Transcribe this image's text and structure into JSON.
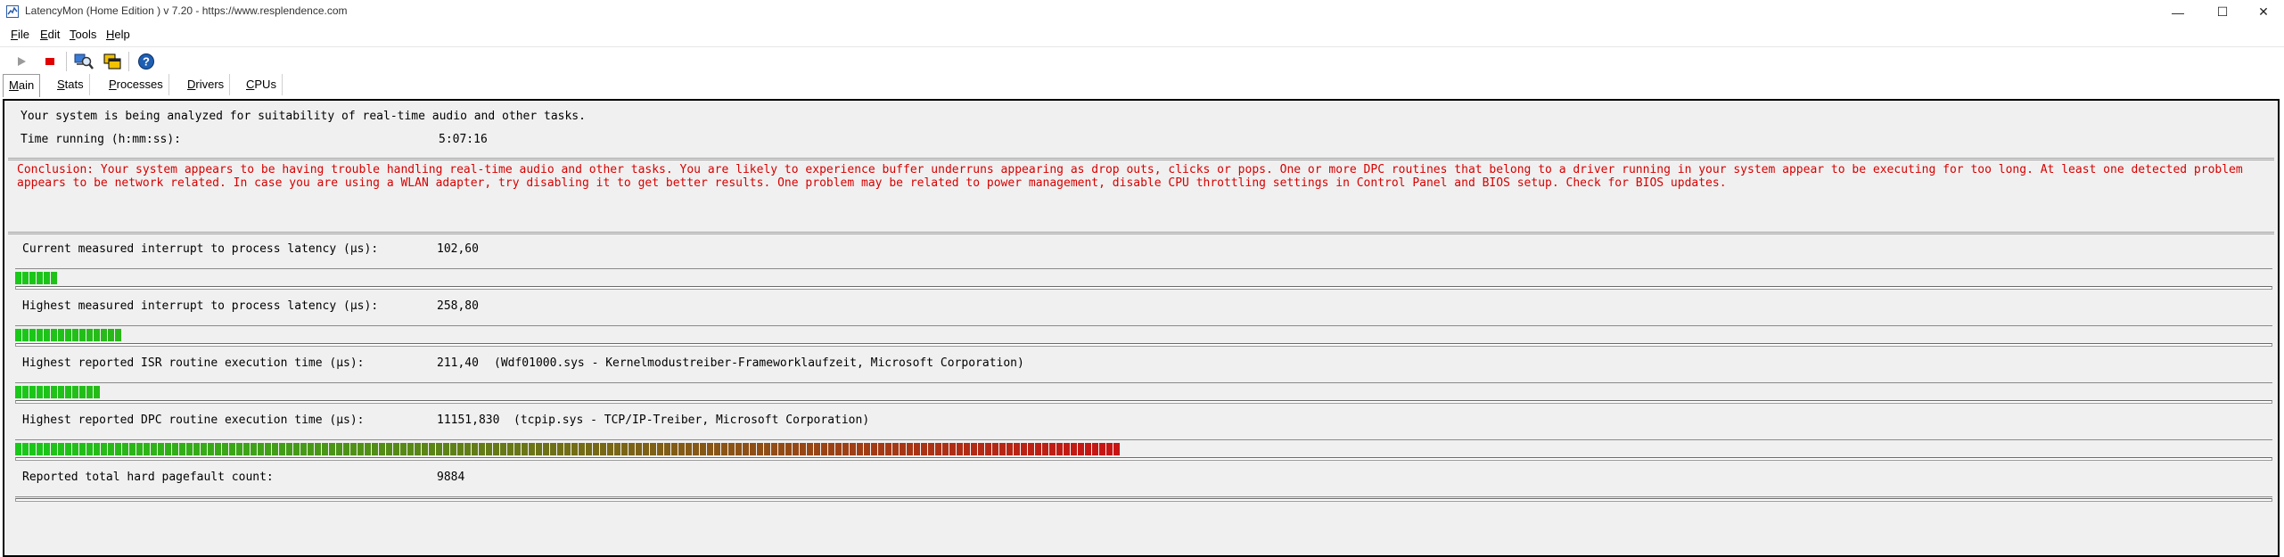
{
  "window": {
    "title": "LatencyMon  (Home Edition )  v 7.20 - https://www.resplendence.com",
    "minimize_glyph": "—",
    "maximize_glyph": "☐",
    "close_glyph": "✕"
  },
  "menu": [
    {
      "acc": "F",
      "rest": "ile"
    },
    {
      "acc": "E",
      "rest": "dit"
    },
    {
      "acc": "T",
      "rest": "ools"
    },
    {
      "acc": "H",
      "rest": "elp"
    }
  ],
  "toolbar": {
    "icons": [
      "play-icon",
      "stop-icon",
      "driver-search-icon",
      "windows-icon",
      "help-icon"
    ],
    "colors": {
      "stop": "#e00000",
      "help": "#1e5fb4"
    }
  },
  "tabs": [
    {
      "acc": "M",
      "rest": "ain",
      "active": true
    },
    {
      "acc": "S",
      "rest": "tats",
      "active": false
    },
    {
      "acc": "P",
      "rest": "rocesses",
      "active": false
    },
    {
      "acc": "D",
      "rest": "rivers",
      "active": false
    },
    {
      "acc": "C",
      "rest": "PUs",
      "active": false
    }
  ],
  "status": {
    "analyzing": "Your system is being analyzed for suitability of real-time audio and other tasks.",
    "time_label": "Time running (h:mm:ss):",
    "time_value": "5:07:16"
  },
  "conclusion": {
    "text": "Conclusion: Your system appears to be having trouble handling real-time audio and other tasks. You are likely to experience buffer underruns appearing as drop outs, clicks or pops. One or more DPC routines that belong to a driver running in your system appear to be executing for too long. At least one detected problem appears to be network related. In case you are using a WLAN adapter, try disabling it to get better results. One problem may be related to power management, disable CPU throttling settings in Control Panel and BIOS setup. Check for BIOS updates.",
    "color": "#d80000"
  },
  "metrics": [
    {
      "label": "Current measured interrupt to process latency (µs):",
      "value": "102,60",
      "detail": "",
      "segments": 6
    },
    {
      "label": "Highest measured interrupt to process latency (µs):",
      "value": "258,80",
      "detail": "",
      "segments": 15
    },
    {
      "label": "Highest reported ISR routine execution time (µs):",
      "value": "211,40",
      "detail": "(Wdf01000.sys - Kernelmodustreiber-Frameworklaufzeit, Microsoft Corporation)",
      "segments": 12
    },
    {
      "label": "Highest reported DPC routine execution time (µs):",
      "value": "11151,830",
      "detail": "(tcpip.sys - TCP/IP-Treiber, Microsoft Corporation)",
      "segments": 155
    },
    {
      "label": "Reported total hard pagefault count:",
      "value": "9884",
      "detail": "",
      "segments": 0
    }
  ],
  "meter": {
    "fill_fraction_max_segments": 320,
    "green": "#19c819",
    "red": "#c81414"
  }
}
